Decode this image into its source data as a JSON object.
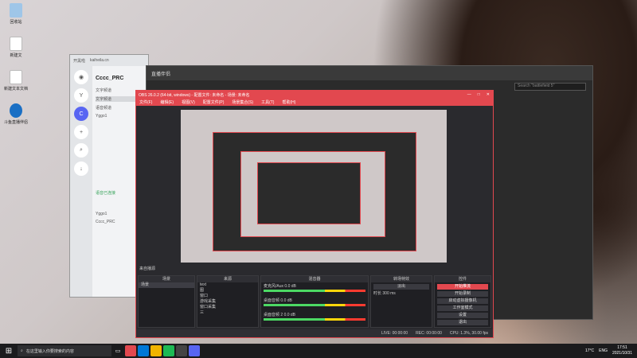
{
  "desktop": {
    "icons": [
      {
        "label": "回收站"
      },
      {
        "label": "新建文"
      },
      {
        "label": "新建文本文档"
      },
      {
        "label": "斗鱼直播伴侣"
      }
    ]
  },
  "discord": {
    "title": "开黑啦",
    "url": "kaiheila.cn",
    "server_name": "Cccc_PRC",
    "section_text": "文字频道",
    "channel_selected": "文字频道",
    "section_voice": "语音频道",
    "voice_channel": "Yggo1",
    "voice_label": "语音已连接",
    "user_name": "Yggo1",
    "user_status": "Cccc_PRC",
    "server_letter": "Y",
    "server_icon_letter": "C"
  },
  "back_app": {
    "title": "直播伴侣",
    "search_placeholder": "Search \"battlefield 5\""
  },
  "obs": {
    "title": "OBS 26.0.2 (64-bit, windows) - 配置文件: 未命名 - 场景: 未命名",
    "menu": [
      "文件(F)",
      "编辑(E)",
      "视图(V)",
      "配置文件(P)",
      "场景集合(S)",
      "工具(T)",
      "帮助(H)"
    ],
    "dock_header_label": "来自播源",
    "docks": {
      "scenes": {
        "title": "场景",
        "items": [
          "场景"
        ]
      },
      "sources": {
        "title": "来源",
        "items": [
          "text",
          "图",
          "窗口",
          "游戏采集",
          "窗口采集",
          "三"
        ]
      },
      "mixer": {
        "title": "混音器",
        "tracks": [
          "麦克风/Aux",
          "桌面音频",
          "桌面音频 2"
        ],
        "levels": [
          "0.0 dB",
          "0.0 dB",
          "0.0 dB"
        ]
      },
      "transitions": {
        "title": "转场特效",
        "type": "淡出",
        "duration_label": "时长",
        "duration": "300 ms"
      },
      "controls": {
        "title": "控件",
        "buttons": [
          "开始推流",
          "开始录制",
          "启动虚拟摄像机",
          "工作室模式",
          "设置",
          "退出"
        ]
      }
    },
    "status": {
      "live": "LIVE: 00:00:00",
      "rec": "REC: 00:00:00",
      "cpu": "CPU: 1.3%, 30.00 fps"
    }
  },
  "taskbar": {
    "search_placeholder": "在这里输入你要搜索的内容",
    "weather": "17°C",
    "lang": "ENG",
    "time": "17:51",
    "date": "2021/10/31"
  }
}
